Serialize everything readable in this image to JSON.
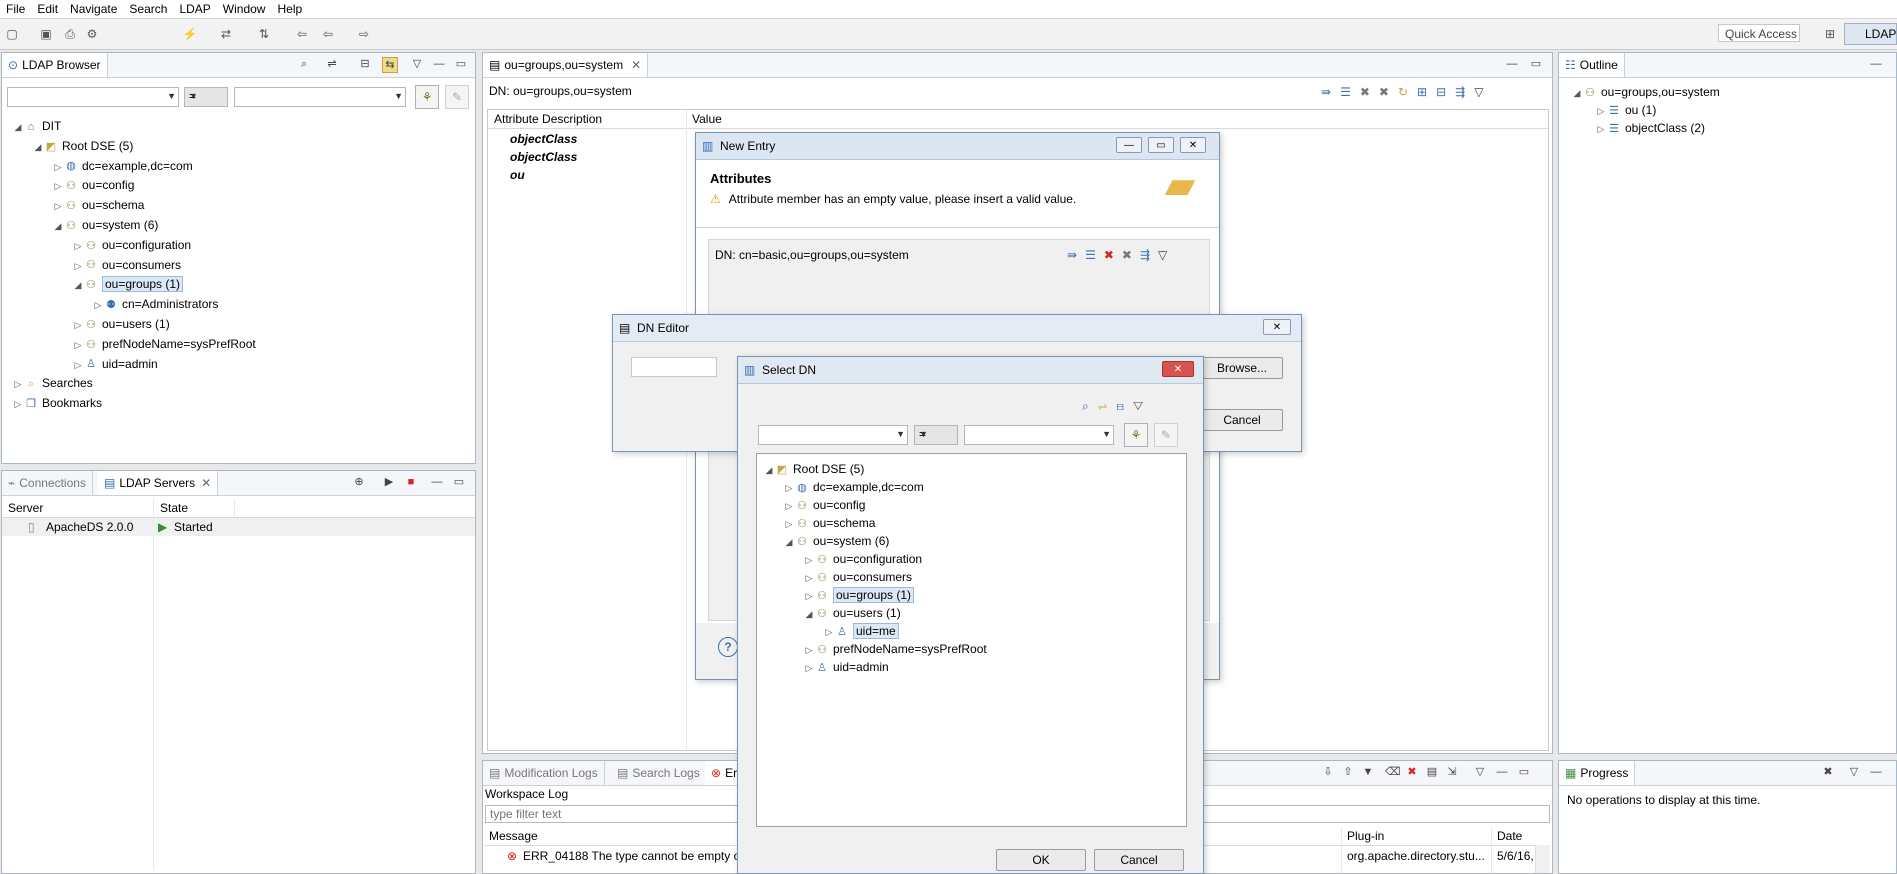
{
  "menu": [
    "File",
    "Edit",
    "Navigate",
    "Search",
    "LDAP",
    "Window",
    "Help"
  ],
  "toolbar": {
    "quick_access": "Quick Access",
    "perspective": "LDAP"
  },
  "browser": {
    "tab": "LDAP Browser",
    "filter_op": "=",
    "tree": [
      {
        "label": "DIT",
        "depth": 0,
        "twisty": "open",
        "icon": "dit-icon"
      },
      {
        "label": "Root DSE (5)",
        "depth": 1,
        "twisty": "open",
        "icon": "root-dse-icon"
      },
      {
        "label": "dc=example,dc=com",
        "depth": 2,
        "twisty": "closed",
        "icon": "globe-icon"
      },
      {
        "label": "ou=config",
        "depth": 2,
        "twisty": "closed",
        "icon": "ou-icon"
      },
      {
        "label": "ou=schema",
        "depth": 2,
        "twisty": "closed",
        "icon": "ou-icon"
      },
      {
        "label": "ou=system (6)",
        "depth": 2,
        "twisty": "open",
        "icon": "ou-icon"
      },
      {
        "label": "ou=configuration",
        "depth": 3,
        "twisty": "closed",
        "icon": "ou-icon"
      },
      {
        "label": "ou=consumers",
        "depth": 3,
        "twisty": "closed",
        "icon": "ou-icon"
      },
      {
        "label": "ou=groups (1)",
        "depth": 3,
        "twisty": "open",
        "icon": "ou-icon",
        "selected": true
      },
      {
        "label": "cn=Administrators",
        "depth": 4,
        "twisty": "closed",
        "icon": "group-icon"
      },
      {
        "label": "ou=users (1)",
        "depth": 3,
        "twisty": "closed",
        "icon": "ou-icon"
      },
      {
        "label": "prefNodeName=sysPrefRoot",
        "depth": 3,
        "twisty": "closed",
        "icon": "ou-icon"
      },
      {
        "label": "uid=admin",
        "depth": 3,
        "twisty": "closed",
        "icon": "user-icon"
      },
      {
        "label": "Searches",
        "depth": 0,
        "twisty": "closed",
        "icon": "searches-icon"
      },
      {
        "label": "Bookmarks",
        "depth": 0,
        "twisty": "closed",
        "icon": "bookmarks-icon"
      }
    ]
  },
  "servers": {
    "tabs": [
      "Connections",
      "LDAP Servers"
    ],
    "columns": [
      "Server",
      "State"
    ],
    "rows": [
      {
        "server": "ApacheDS 2.0.0",
        "state": "Started"
      }
    ]
  },
  "editor": {
    "tab": "ou=groups,ou=system",
    "dn": "DN: ou=groups,ou=system",
    "columns": [
      "Attribute Description",
      "Value"
    ],
    "rows": [
      {
        "attr": "objectClass",
        "value": ""
      },
      {
        "attr": "objectClass",
        "value": ""
      },
      {
        "attr": "ou",
        "value": ""
      }
    ]
  },
  "outline": {
    "tab": "Outline",
    "items": [
      {
        "label": "ou=groups,ou=system",
        "depth": 0,
        "twisty": "open"
      },
      {
        "label": "ou (1)",
        "depth": 1,
        "twisty": "closed"
      },
      {
        "label": "objectClass (2)",
        "depth": 1,
        "twisty": "closed"
      }
    ]
  },
  "logs": {
    "tabs": [
      "Modification Logs",
      "Search Logs",
      "Er"
    ],
    "title": "Workspace Log",
    "filter_placeholder": "type filter text",
    "columns": [
      "Message",
      "Plug-in",
      "Date"
    ],
    "rows": [
      {
        "message": "ERR_04188 The type cannot be empty or",
        "plugin": "org.apache.directory.stu...",
        "date": "5/6/16,"
      }
    ]
  },
  "progress": {
    "tab": "Progress",
    "text": "No operations to display at this time."
  },
  "new_entry": {
    "title": "New Entry",
    "heading": "Attributes",
    "message": "Attribute member has an empty value, please insert a valid value.",
    "dn": "DN: cn=basic,ou=groups,ou=system"
  },
  "dn_editor": {
    "title": "DN Editor",
    "browse": "Browse...",
    "cancel": "Cancel"
  },
  "select_dn": {
    "title": "Select DN",
    "filter_op": "=",
    "tree": [
      {
        "label": "Root DSE (5)",
        "depth": 0,
        "twisty": "open",
        "icon": "root-dse-icon"
      },
      {
        "label": "dc=example,dc=com",
        "depth": 1,
        "twisty": "closed",
        "icon": "globe-icon"
      },
      {
        "label": "ou=config",
        "depth": 1,
        "twisty": "closed",
        "icon": "ou-icon"
      },
      {
        "label": "ou=schema",
        "depth": 1,
        "twisty": "closed",
        "icon": "ou-icon"
      },
      {
        "label": "ou=system (6)",
        "depth": 1,
        "twisty": "open",
        "icon": "ou-icon"
      },
      {
        "label": "ou=configuration",
        "depth": 2,
        "twisty": "closed",
        "icon": "ou-icon"
      },
      {
        "label": "ou=consumers",
        "depth": 2,
        "twisty": "closed",
        "icon": "ou-icon"
      },
      {
        "label": "ou=groups (1)",
        "depth": 2,
        "twisty": "closed",
        "icon": "ou-icon",
        "selected": true
      },
      {
        "label": "ou=users (1)",
        "depth": 2,
        "twisty": "open",
        "icon": "ou-icon"
      },
      {
        "label": "uid=me",
        "depth": 3,
        "twisty": "closed",
        "icon": "user-icon",
        "selected": true
      },
      {
        "label": "prefNodeName=sysPrefRoot",
        "depth": 2,
        "twisty": "closed",
        "icon": "ou-icon"
      },
      {
        "label": "uid=admin",
        "depth": 2,
        "twisty": "closed",
        "icon": "user-icon"
      }
    ],
    "ok": "OK",
    "cancel": "Cancel"
  }
}
